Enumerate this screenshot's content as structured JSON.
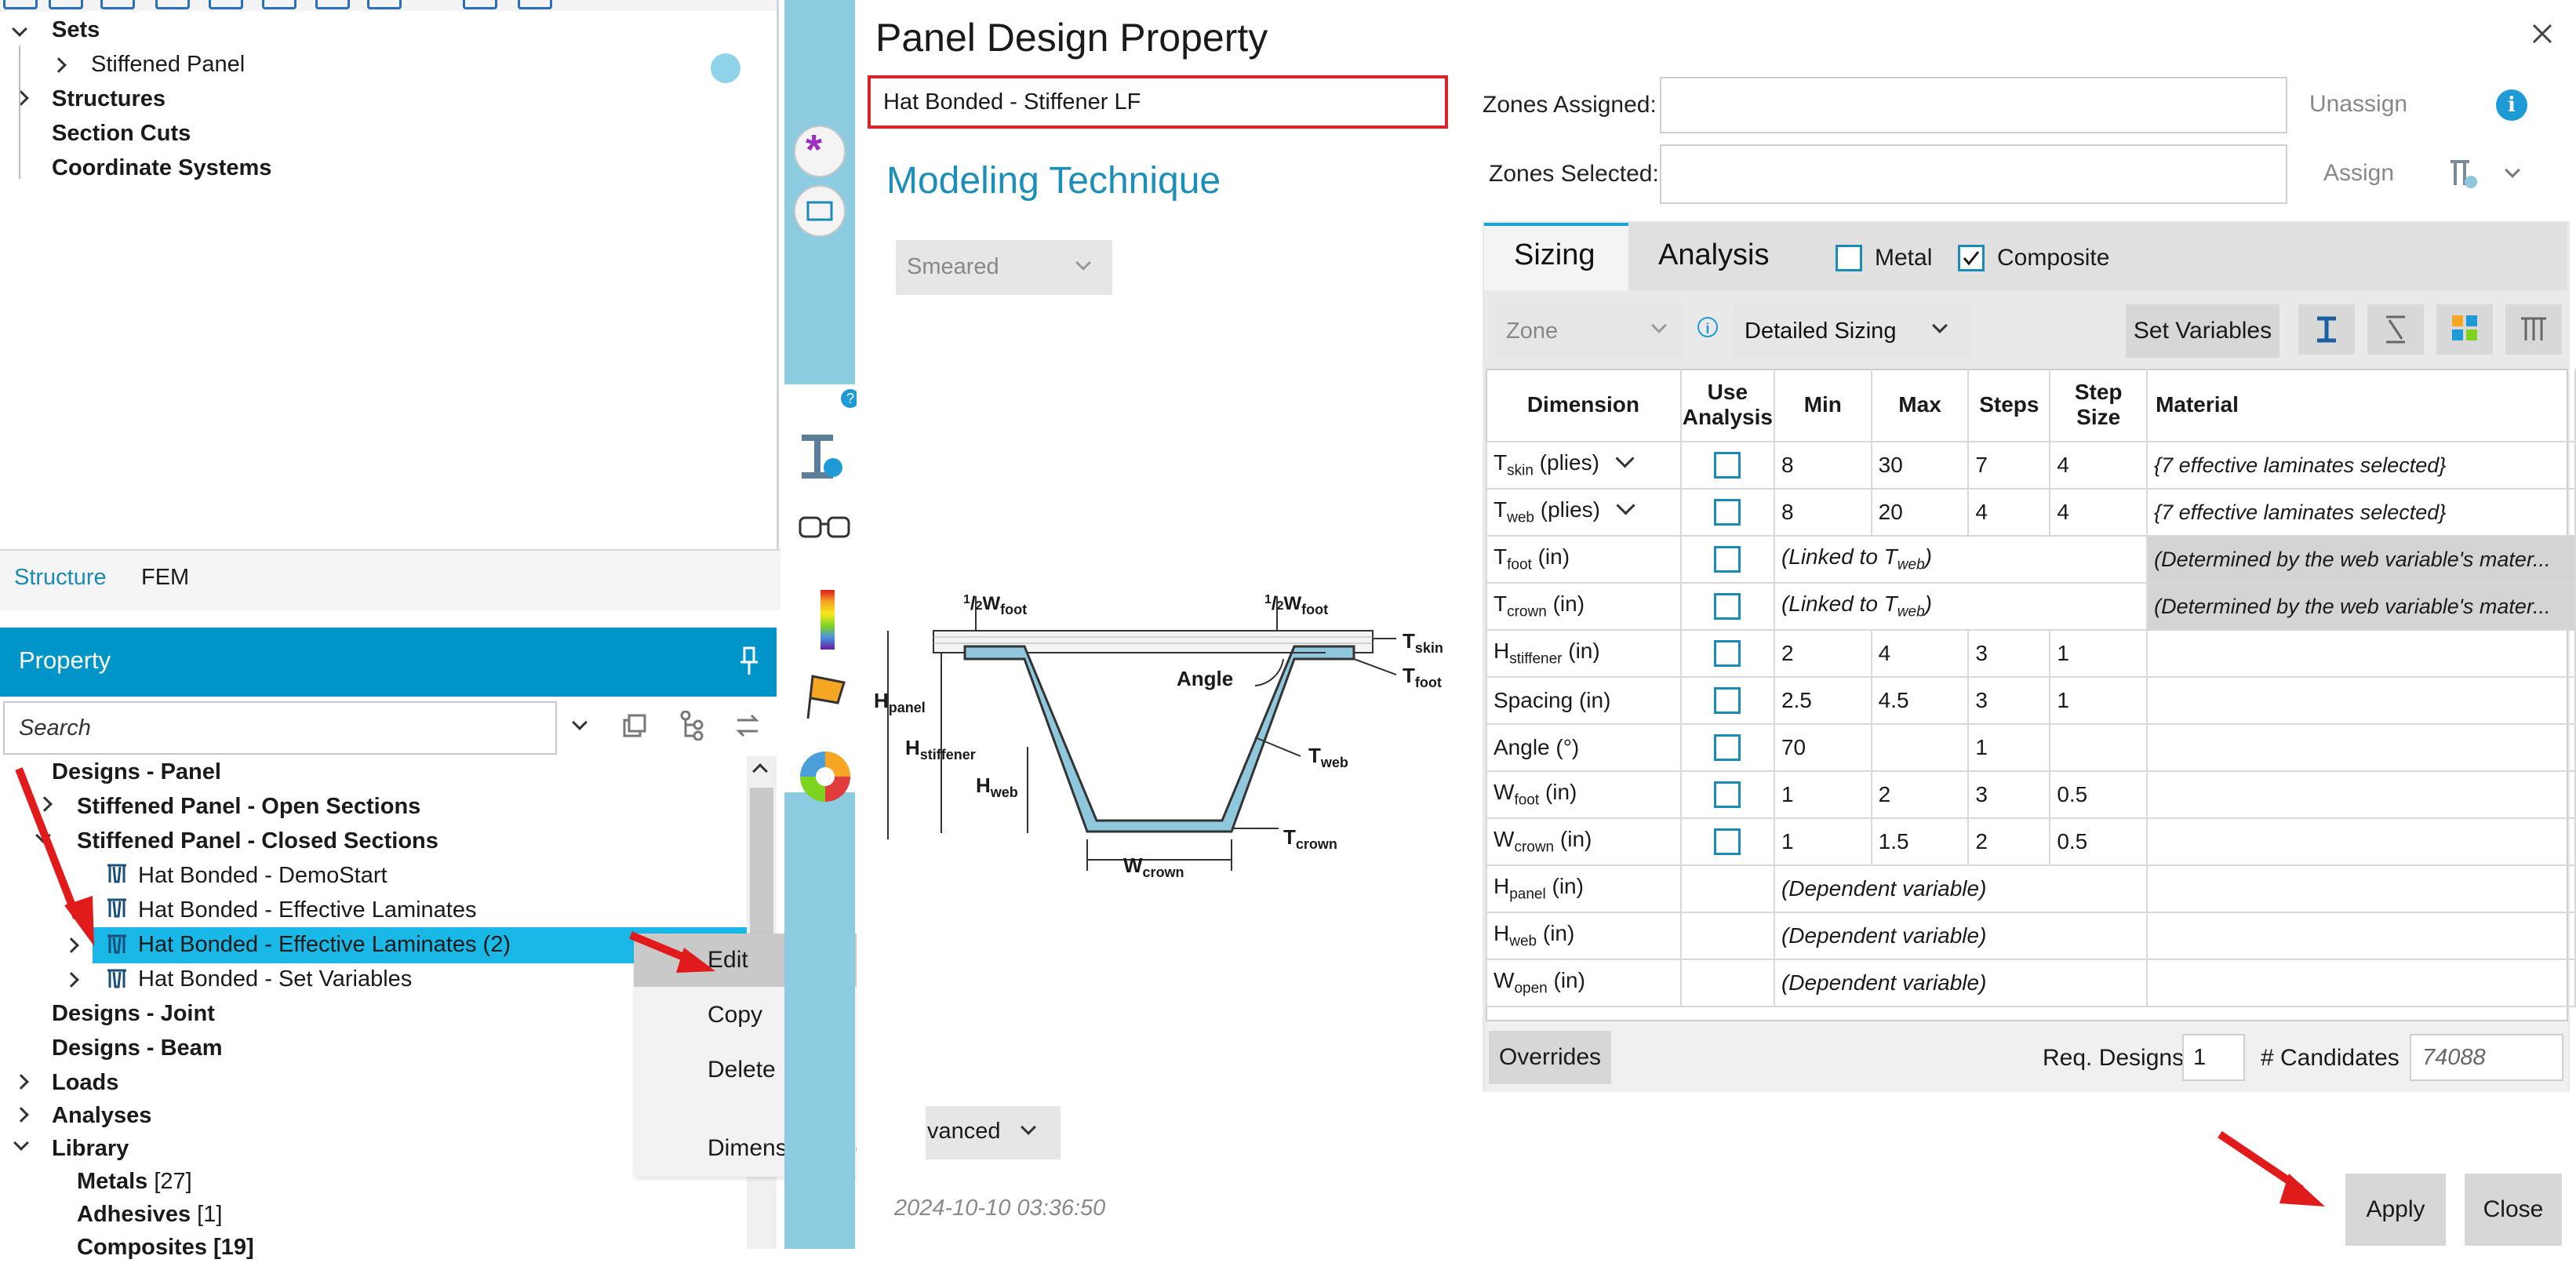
{
  "tree": {
    "sets": "Sets",
    "stiffened_panel": "Stiffened Panel",
    "structures": "Structures",
    "section_cuts": "Section Cuts",
    "coordinate_systems": "Coordinate Systems"
  },
  "tabs": {
    "structure": "Structure",
    "fem": "FEM"
  },
  "property": {
    "header": "Property",
    "search_placeholder": "Search",
    "items": {
      "designs_panel": "Designs - Panel",
      "open_sections": "Stiffened Panel - Open Sections",
      "closed_sections": "Stiffened Panel - Closed Sections",
      "demo_start": "Hat Bonded - DemoStart",
      "eff_lam": "Hat Bonded - Effective Laminates",
      "eff_lam2": "Hat Bonded - Effective Laminates (2)",
      "set_vars": "Hat Bonded - Set Variables",
      "designs_joint": "Designs - Joint",
      "designs_beam": "Designs - Beam",
      "loads": "Loads",
      "analyses": "Analyses",
      "library": "Library",
      "metals": "Metals",
      "metals_count": "[27]",
      "adhesives": "Adhesives",
      "adhesives_count": "[1]",
      "composites": "Composites [19]"
    }
  },
  "context_menu": {
    "edit": "Edit",
    "copy": "Copy",
    "delete": "Delete",
    "overrides": "Dimension Overrides"
  },
  "dialog": {
    "title": "Panel Design Property",
    "name_value": "Hat Bonded - Stiffener LF",
    "modeling_technique": "Modeling Technique",
    "smeared": "Smeared",
    "advanced": "vanced",
    "timestamp": "2024-10-10 03:36:50",
    "zones_assigned": "Zones Assigned:",
    "zones_selected": "Zones Selected:",
    "unassign": "Unassign",
    "assign": "Assign",
    "apply": "Apply",
    "close": "Close"
  },
  "diagram": {
    "half": "1",
    "half_den": "2",
    "w_foot_l": "W",
    "w_foot_sub": "foot",
    "t_skin": "T",
    "t_skin_sub": "skin",
    "t_foot": "T",
    "t_foot_sub": "foot",
    "angle": "Angle",
    "h_panel": "H",
    "h_panel_sub": "panel",
    "h_stiffener": "H",
    "h_stiffener_sub": "stiffener",
    "h_web": "H",
    "h_web_sub": "web",
    "t_web": "T",
    "t_web_sub": "web",
    "t_crown": "T",
    "t_crown_sub": "crown",
    "w_crown": "W",
    "w_crown_sub": "crown"
  },
  "sizing": {
    "tab_sizing": "Sizing",
    "tab_analysis": "Analysis",
    "metal": "Metal",
    "composite": "Composite",
    "zone": "Zone",
    "detailed_sizing": "Detailed Sizing",
    "set_variables": "Set Variables",
    "headers": {
      "dimension": "Dimension",
      "use": "Use",
      "analysis": "Analysis",
      "min": "Min",
      "max": "Max",
      "steps": "Steps",
      "step": "Step",
      "size": "Size",
      "material": "Material"
    },
    "rows": [
      {
        "base": "T",
        "sub": "skin",
        "unit": " (plies)",
        "min": "8",
        "max": "30",
        "steps": "7",
        "step": "4",
        "material": "{7 effective laminates selected}"
      },
      {
        "base": "T",
        "sub": "web",
        "unit": " (plies)",
        "min": "8",
        "max": "20",
        "steps": "4",
        "step": "4",
        "material": "{7 effective laminates selected}"
      },
      {
        "base": "T",
        "sub": "foot",
        "unit": " (in)",
        "linked_pre": "(Linked to T",
        "linked_sub": "web",
        "linked_post": ")",
        "material": "(Determined by the web variable's mater..."
      },
      {
        "base": "T",
        "sub": "crown",
        "unit": " (in)",
        "linked_pre": "(Linked to T",
        "linked_sub": "web",
        "linked_post": ")",
        "material": "(Determined by the web variable's mater..."
      },
      {
        "base": "H",
        "sub": "stiffener",
        "unit": " (in)",
        "min": "2",
        "max": "4",
        "steps": "3",
        "step": "1"
      },
      {
        "base": "Spacing",
        "sub": "",
        "unit": " (in)",
        "min": "2.5",
        "max": "4.5",
        "steps": "3",
        "step": "1"
      },
      {
        "base": "Angle",
        "sub": "",
        "unit": " (°)",
        "min": "70",
        "max": "",
        "steps": "1",
        "step": ""
      },
      {
        "base": "W",
        "sub": "foot",
        "unit": " (in)",
        "min": "1",
        "max": "2",
        "steps": "3",
        "step": "0.5"
      },
      {
        "base": "W",
        "sub": "crown",
        "unit": " (in)",
        "min": "1",
        "max": "1.5",
        "steps": "2",
        "step": "0.5"
      },
      {
        "base": "H",
        "sub": "panel",
        "unit": " (in)",
        "dependent": "(Dependent variable)"
      },
      {
        "base": "H",
        "sub": "web",
        "unit": " (in)",
        "dependent": "(Dependent variable)"
      },
      {
        "base": "W",
        "sub": "open",
        "unit": " (in)",
        "dependent": "(Dependent variable)"
      }
    ],
    "overrides": "Overrides",
    "req_designs_label": "Req. Designs",
    "req_designs_value": "1",
    "candidates_label": "# Candidates",
    "candidates_value": "74088"
  }
}
